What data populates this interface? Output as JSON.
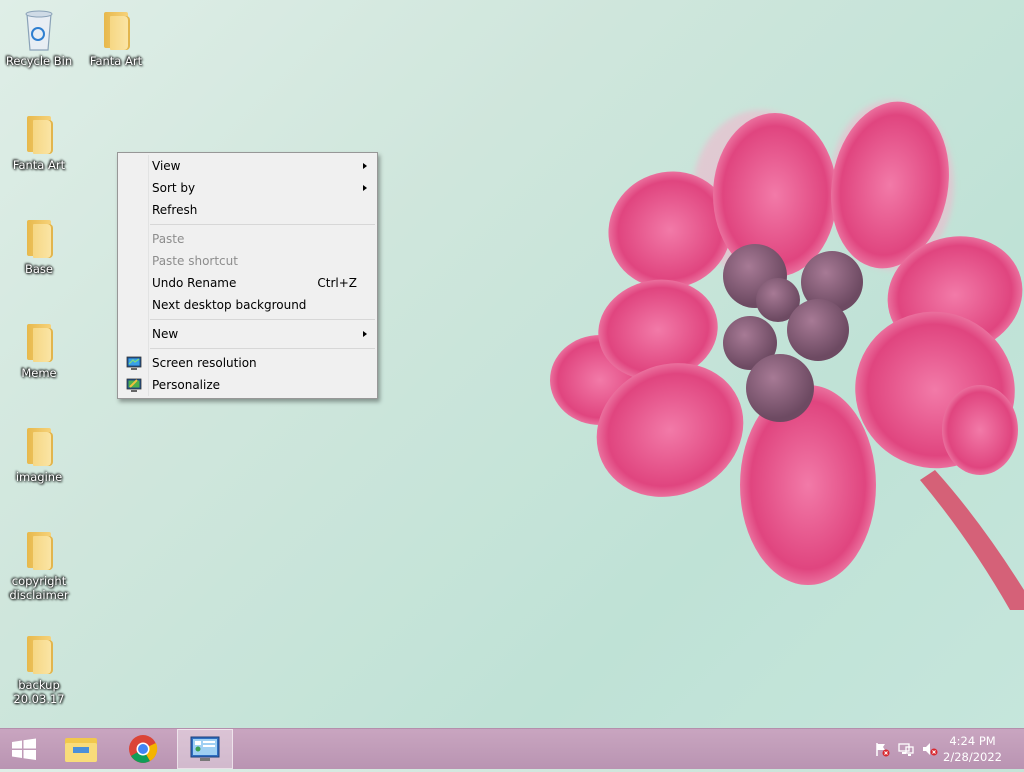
{
  "desktop": {
    "icons": [
      {
        "label": "Recycle Bin",
        "icon": "recycle-bin-icon"
      },
      {
        "label": "Fanta Art",
        "icon": "folder-icon"
      },
      {
        "label": "Fanta Art",
        "icon": "folder-icon"
      },
      {
        "label": "Base",
        "icon": "folder-icon"
      },
      {
        "label": "Meme",
        "icon": "folder-icon"
      },
      {
        "label": "imagine",
        "icon": "folder-icon"
      },
      {
        "label": "copyright\ndisclaimer",
        "icon": "folder-icon"
      },
      {
        "label": "backup\n20.03.17",
        "icon": "folder-icon"
      }
    ]
  },
  "context_menu": {
    "items": [
      {
        "label": "View",
        "submenu": true,
        "enabled": true
      },
      {
        "label": "Sort by",
        "submenu": true,
        "enabled": true
      },
      {
        "label": "Refresh",
        "enabled": true
      },
      {
        "label": "Paste",
        "enabled": false
      },
      {
        "label": "Paste shortcut",
        "enabled": false
      },
      {
        "label": "Undo Rename",
        "shortcut": "Ctrl+Z",
        "enabled": true
      },
      {
        "label": "Next desktop background",
        "enabled": true
      },
      {
        "label": "New",
        "submenu": true,
        "enabled": true
      },
      {
        "label": "Screen resolution",
        "icon": "monitor-icon",
        "enabled": true
      },
      {
        "label": "Personalize",
        "icon": "personalize-icon",
        "enabled": true
      }
    ]
  },
  "taskbar": {
    "buttons": [
      {
        "icon": "windows-start-icon"
      },
      {
        "icon": "file-explorer-icon"
      },
      {
        "icon": "chrome-icon"
      },
      {
        "icon": "control-panel-icon",
        "active": true
      }
    ],
    "tray": [
      "action-center-flag-icon",
      "network-icon",
      "volume-muted-icon"
    ],
    "clock": {
      "time": "4:24 PM",
      "date": "2/28/2022"
    }
  },
  "colors": {
    "menu_bg": "#f0f0f0",
    "taskbar": "#c0a0bb",
    "flower": "#e0457f"
  }
}
